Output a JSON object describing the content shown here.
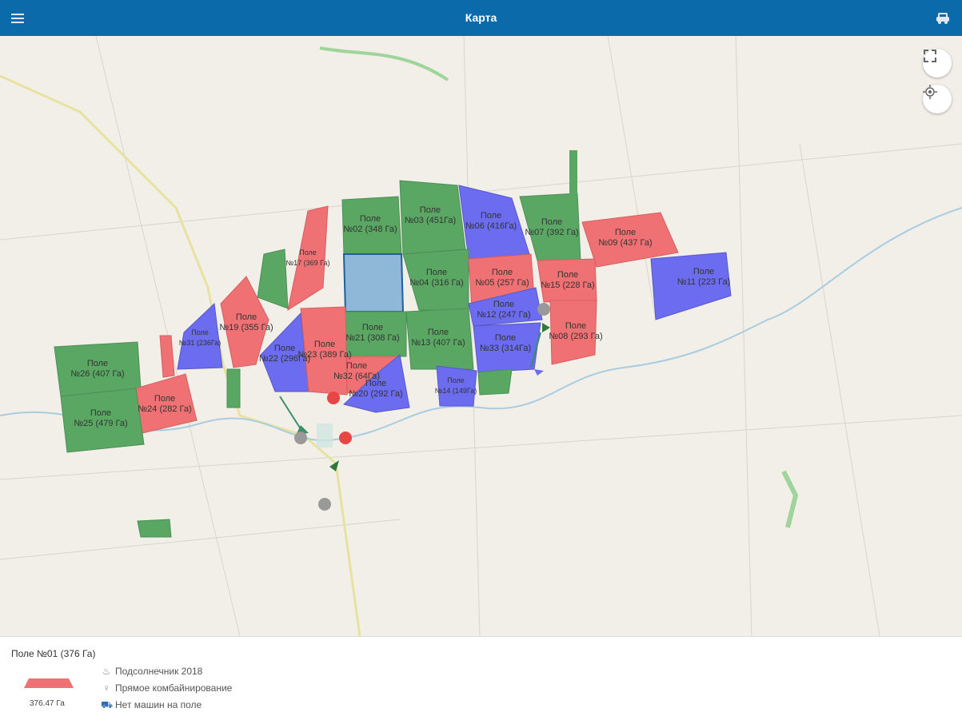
{
  "header": {
    "title": "Карта"
  },
  "colors": {
    "header": "#0b6aaa",
    "green": "#5aa764",
    "red": "#f07173",
    "blue": "#6b6cef",
    "selected": "#8fb8d8",
    "map_bg": "#f2efe9"
  },
  "fields": {
    "f02": {
      "name": "Поле",
      "label": "№02 (348 Га)"
    },
    "f03": {
      "name": "Поле",
      "label": "№03 (451Га)"
    },
    "f06": {
      "name": "Поле",
      "label": "№06 (416Га)"
    },
    "f07": {
      "name": "Поле",
      "label": "№07 (392 Га)"
    },
    "f09": {
      "name": "Поле",
      "label": "№09 (437 Га)"
    },
    "f17": {
      "name": "Поле",
      "label": "№17 (369 Га)"
    },
    "f04": {
      "name": "Поле",
      "label": "№04 (316 Га)"
    },
    "f05": {
      "name": "Поле",
      "label": "№05 (257 Га)"
    },
    "f15": {
      "name": "Поле",
      "label": "№15 (228 Га)"
    },
    "f11": {
      "name": "Поле",
      "label": "№11 (223 Га)"
    },
    "f19": {
      "name": "Поле",
      "label": "№19 (355 Га)"
    },
    "f21": {
      "name": "Поле",
      "label": "№21 (308 Га)"
    },
    "f13": {
      "name": "Поле",
      "label": "№13 (407 Га)"
    },
    "f12": {
      "name": "Поле",
      "label": "№12 (247 Га)"
    },
    "f33": {
      "name": "Поле",
      "label": "№33 (314Га)"
    },
    "f08": {
      "name": "Поле",
      "label": "№08 (293 Га)"
    },
    "f31": {
      "name": "Поле",
      "label": "№31 (236Га)"
    },
    "f22": {
      "name": "Поле",
      "label": "№22 (296Га)"
    },
    "f23": {
      "name": "Поле",
      "label": "№23 (389 Га)"
    },
    "f32": {
      "name": "Поле",
      "label": "№32 (64Га)"
    },
    "f20": {
      "name": "Поле",
      "label": "№20 (292 Га)"
    },
    "f14": {
      "name": "Поле",
      "label": "№14 (149Га)"
    },
    "f26": {
      "name": "Поле",
      "label": "№26 (407 Га)"
    },
    "f24": {
      "name": "Поле",
      "label": "№24 (282 Га)"
    },
    "f25": {
      "name": "Поле",
      "label": "№25 (479 Га)"
    }
  },
  "panel": {
    "title": "Поле №01 (376 Га)",
    "area": "376.47 Га",
    "crop": "Подсолнечник 2018",
    "method": "Прямое комбайнирование",
    "machines": "Нет машин на поле"
  }
}
